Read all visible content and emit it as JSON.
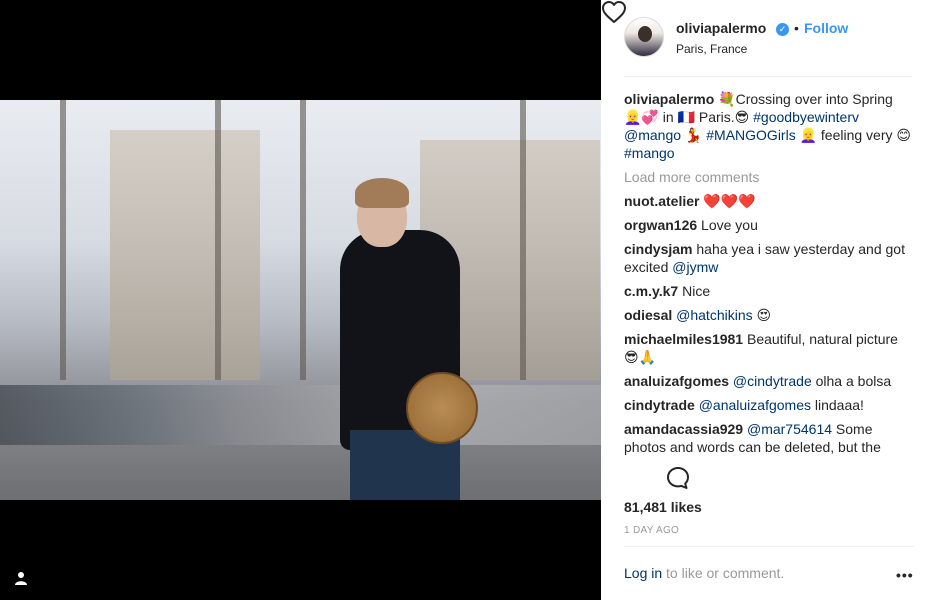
{
  "post": {
    "username": "oliviapalermo",
    "verified_glyph": "✓",
    "separator": "•",
    "follow_label": "Follow",
    "location": "Paris, France",
    "caption": {
      "username": "oliviapalermo",
      "part1": " 💐Crossing over into Spring 👱‍♀️💞 in 🇫🇷 Paris.😎 ",
      "hashtag1": "#goodbyewinterv",
      "mention1": "@mango",
      "part2": " 💃 ",
      "hashtag2": "#MANGOGirls",
      "part3": " 👱‍♀️ feeling very 😊",
      "hashtag3": "#mango"
    },
    "load_more": "Load more comments",
    "comments": [
      {
        "user": "nuot.atelier",
        "text": " ❤️❤️❤️",
        "mention": ""
      },
      {
        "user": "orgwan126",
        "text": " Love you",
        "mention": ""
      },
      {
        "user": "cindysjam",
        "text": " haha yea i saw yesterday and got excited ",
        "mention": "@jymw"
      },
      {
        "user": "c.m.y.k7",
        "text": " Nice",
        "mention": ""
      },
      {
        "user": "odiesal",
        "text": " 😍",
        "mention": "@hatchikins",
        "mention_first": true
      },
      {
        "user": "michaelmiles1981",
        "text": " Beautiful, natural picture 😎🙏",
        "mention": ""
      },
      {
        "user": "analuizafgomes",
        "text": " olha a bolsa",
        "mention": "@cindytrade",
        "mention_first": true
      },
      {
        "user": "cindytrade",
        "text": " lindaaa!",
        "mention": "@analuizafgomes",
        "mention_first": true
      },
      {
        "user": "amandacassia929",
        "text": " Some photos and words can be deleted, but the",
        "mention": "@mar754614",
        "mention_first": true
      }
    ],
    "likes": "81,481 likes",
    "time": "1 DAY AGO",
    "login_link": "Log in",
    "login_rest": " to like or comment.",
    "more_glyph": "•••"
  }
}
